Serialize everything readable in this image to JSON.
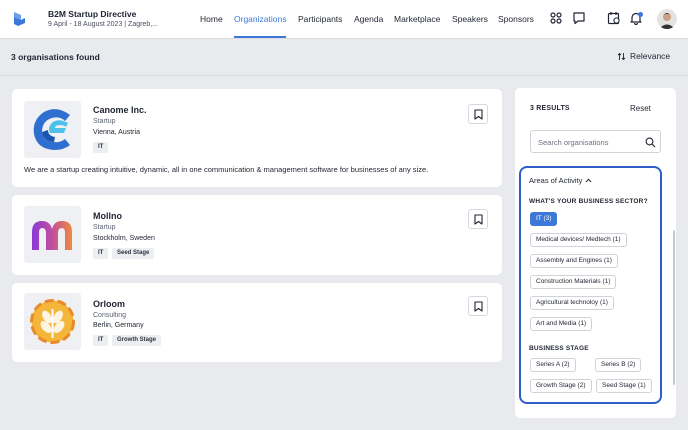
{
  "header": {
    "event_title": "B2M Startup Directive",
    "event_dates": "9 April - 18 August 2023 | Zagreb,...",
    "nav": [
      "Home",
      "Organizations",
      "Participants",
      "Agenda",
      "Marketplace",
      "Speakers",
      "Sponsors"
    ],
    "active_nav": "Organizations",
    "icons": [
      "grid-icon",
      "chat-icon",
      "calendar-icon",
      "bell-icon"
    ],
    "accent_color": "#3d78d8"
  },
  "subheader": {
    "found_text": "3 organisations found",
    "sort_label": "Relevance"
  },
  "organizations": [
    {
      "name": "Canome Inc.",
      "type": "Startup",
      "location": "Vienna, Austria",
      "tags": [
        "IT"
      ],
      "description": "We are a startup creating intuitive, dynamic, all in one communication & management software for businesses of any size."
    },
    {
      "name": "Mollno",
      "type": "Startup",
      "location": "Stockholm, Sweden",
      "tags": [
        "IT",
        "Seed Stage"
      ]
    },
    {
      "name": "Orloom",
      "type": "Consulting",
      "location": "Berlin, Germany",
      "tags": [
        "IT",
        "Growth Stage"
      ]
    }
  ],
  "filters": {
    "results_label": "3 RESULTS",
    "reset_label": "Reset",
    "search_placeholder": "Search organisations",
    "areas_title": "Areas of Activity",
    "sector_label": "WHAT'S YOUR BUSINESS SECTOR?",
    "sector_chips": [
      "IT (3)",
      "Medical devices/ Medtech (1)",
      "Assembly and Engines (1)",
      "Construction Materials (1)",
      "Agricultural technoloy (1)",
      "Art and Media (1)"
    ],
    "selected_sector": "IT (3)",
    "stage_label": "BUSINESS STAGE",
    "stage_chips": [
      "Series A (2)",
      "Series B (2)",
      "Growth Stage (2)",
      "Seed Stage (1)"
    ],
    "highlight_color": "#2f5ec8"
  }
}
